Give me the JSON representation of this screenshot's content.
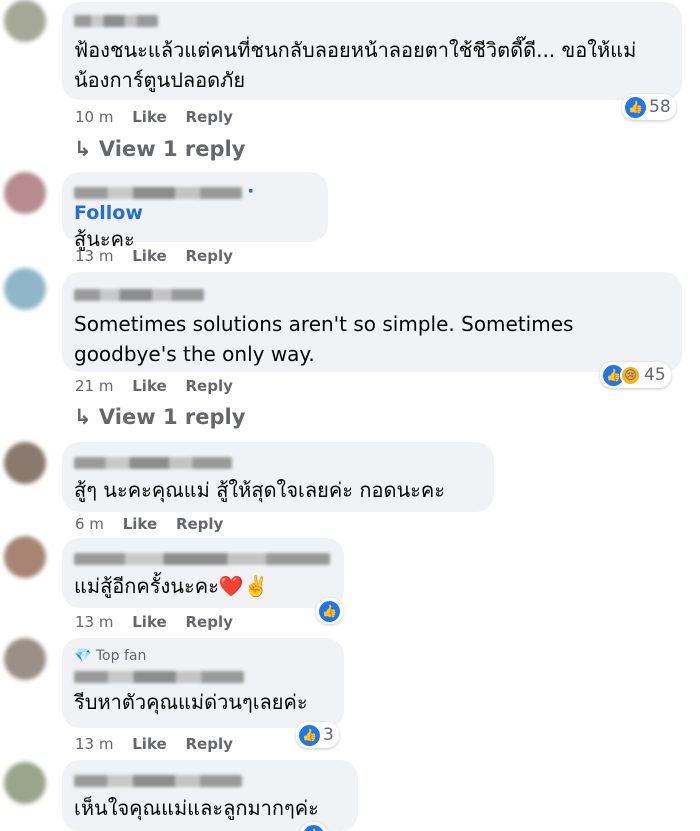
{
  "comments": [
    {
      "text": "ฟ้องชนะแล้วแต่คนที่ชนกลับลอยหน้าลอยตาใช้ชีวิตดี๊ดี... ขอให้แม่น้องการ์ตูนปลอดภัย",
      "time": "10 m",
      "like": "Like",
      "reply": "Reply",
      "reactions": {
        "count": "58",
        "icons": [
          "like-icon"
        ]
      },
      "view_reply": "↳ View 1 reply",
      "avatar_color": "#a5a896"
    },
    {
      "follow": "· Follow",
      "text": "สู้นะคะ",
      "time": "13 m",
      "like": "Like",
      "reply": "Reply",
      "avatar_color": "#b78b90"
    },
    {
      "text": "Sometimes solutions aren't so simple. Sometimes goodbye's the only way.",
      "time": "21 m",
      "like": "Like",
      "reply": "Reply",
      "reactions": {
        "count": "45",
        "icons": [
          "like-icon",
          "sad-icon"
        ]
      },
      "view_reply": "↳ View 1 reply",
      "avatar_color": "#8fb7c9"
    },
    {
      "text": "สู้ๆ นะคะคุณแม่ สู้ให้สุดใจเลยค่ะ กอดนะคะ",
      "time": "6 m",
      "like": "Like",
      "reply": "Reply",
      "avatar_color": "#8a7a6e"
    },
    {
      "text": "แม่สู้อีกครั้งนะคะ❤️✌️",
      "time": "13 m",
      "like": "Like",
      "reply": "Reply",
      "reactions": {
        "count": "",
        "icons": [
          "like-icon"
        ]
      },
      "avatar_color": "#a88474"
    },
    {
      "badge": "💎 Top fan",
      "text": "รีบหาตัวคุณแม่ด่วนๆเลยค่ะ",
      "time": "13 m",
      "like": "Like",
      "reply": "Reply",
      "reactions": {
        "count": "3",
        "icons": [
          "like-icon"
        ]
      },
      "avatar_color": "#9b8f87"
    },
    {
      "text": "เห็นใจคุณแม่และลูกมากๆค่ะ",
      "avatar_color": "#9aa58c"
    }
  ],
  "colors": {
    "bubble": "#f0f2f5",
    "link": "#216fdb",
    "meta": "#65676b",
    "like": "#1a78f4"
  }
}
